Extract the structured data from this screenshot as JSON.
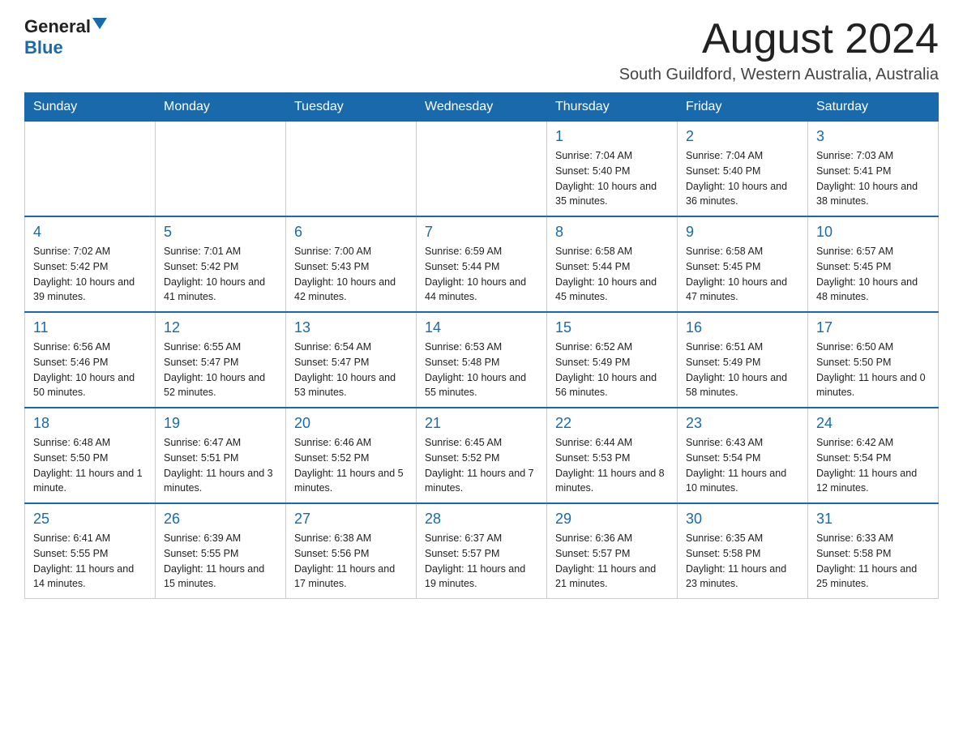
{
  "header": {
    "logo_general": "General",
    "logo_blue": "Blue",
    "month_title": "August 2024",
    "subtitle": "South Guildford, Western Australia, Australia"
  },
  "weekdays": [
    "Sunday",
    "Monday",
    "Tuesday",
    "Wednesday",
    "Thursday",
    "Friday",
    "Saturday"
  ],
  "weeks": [
    [
      {
        "day": "",
        "info": ""
      },
      {
        "day": "",
        "info": ""
      },
      {
        "day": "",
        "info": ""
      },
      {
        "day": "",
        "info": ""
      },
      {
        "day": "1",
        "info": "Sunrise: 7:04 AM\nSunset: 5:40 PM\nDaylight: 10 hours and 35 minutes."
      },
      {
        "day": "2",
        "info": "Sunrise: 7:04 AM\nSunset: 5:40 PM\nDaylight: 10 hours and 36 minutes."
      },
      {
        "day": "3",
        "info": "Sunrise: 7:03 AM\nSunset: 5:41 PM\nDaylight: 10 hours and 38 minutes."
      }
    ],
    [
      {
        "day": "4",
        "info": "Sunrise: 7:02 AM\nSunset: 5:42 PM\nDaylight: 10 hours and 39 minutes."
      },
      {
        "day": "5",
        "info": "Sunrise: 7:01 AM\nSunset: 5:42 PM\nDaylight: 10 hours and 41 minutes."
      },
      {
        "day": "6",
        "info": "Sunrise: 7:00 AM\nSunset: 5:43 PM\nDaylight: 10 hours and 42 minutes."
      },
      {
        "day": "7",
        "info": "Sunrise: 6:59 AM\nSunset: 5:44 PM\nDaylight: 10 hours and 44 minutes."
      },
      {
        "day": "8",
        "info": "Sunrise: 6:58 AM\nSunset: 5:44 PM\nDaylight: 10 hours and 45 minutes."
      },
      {
        "day": "9",
        "info": "Sunrise: 6:58 AM\nSunset: 5:45 PM\nDaylight: 10 hours and 47 minutes."
      },
      {
        "day": "10",
        "info": "Sunrise: 6:57 AM\nSunset: 5:45 PM\nDaylight: 10 hours and 48 minutes."
      }
    ],
    [
      {
        "day": "11",
        "info": "Sunrise: 6:56 AM\nSunset: 5:46 PM\nDaylight: 10 hours and 50 minutes."
      },
      {
        "day": "12",
        "info": "Sunrise: 6:55 AM\nSunset: 5:47 PM\nDaylight: 10 hours and 52 minutes."
      },
      {
        "day": "13",
        "info": "Sunrise: 6:54 AM\nSunset: 5:47 PM\nDaylight: 10 hours and 53 minutes."
      },
      {
        "day": "14",
        "info": "Sunrise: 6:53 AM\nSunset: 5:48 PM\nDaylight: 10 hours and 55 minutes."
      },
      {
        "day": "15",
        "info": "Sunrise: 6:52 AM\nSunset: 5:49 PM\nDaylight: 10 hours and 56 minutes."
      },
      {
        "day": "16",
        "info": "Sunrise: 6:51 AM\nSunset: 5:49 PM\nDaylight: 10 hours and 58 minutes."
      },
      {
        "day": "17",
        "info": "Sunrise: 6:50 AM\nSunset: 5:50 PM\nDaylight: 11 hours and 0 minutes."
      }
    ],
    [
      {
        "day": "18",
        "info": "Sunrise: 6:48 AM\nSunset: 5:50 PM\nDaylight: 11 hours and 1 minute."
      },
      {
        "day": "19",
        "info": "Sunrise: 6:47 AM\nSunset: 5:51 PM\nDaylight: 11 hours and 3 minutes."
      },
      {
        "day": "20",
        "info": "Sunrise: 6:46 AM\nSunset: 5:52 PM\nDaylight: 11 hours and 5 minutes."
      },
      {
        "day": "21",
        "info": "Sunrise: 6:45 AM\nSunset: 5:52 PM\nDaylight: 11 hours and 7 minutes."
      },
      {
        "day": "22",
        "info": "Sunrise: 6:44 AM\nSunset: 5:53 PM\nDaylight: 11 hours and 8 minutes."
      },
      {
        "day": "23",
        "info": "Sunrise: 6:43 AM\nSunset: 5:54 PM\nDaylight: 11 hours and 10 minutes."
      },
      {
        "day": "24",
        "info": "Sunrise: 6:42 AM\nSunset: 5:54 PM\nDaylight: 11 hours and 12 minutes."
      }
    ],
    [
      {
        "day": "25",
        "info": "Sunrise: 6:41 AM\nSunset: 5:55 PM\nDaylight: 11 hours and 14 minutes."
      },
      {
        "day": "26",
        "info": "Sunrise: 6:39 AM\nSunset: 5:55 PM\nDaylight: 11 hours and 15 minutes."
      },
      {
        "day": "27",
        "info": "Sunrise: 6:38 AM\nSunset: 5:56 PM\nDaylight: 11 hours and 17 minutes."
      },
      {
        "day": "28",
        "info": "Sunrise: 6:37 AM\nSunset: 5:57 PM\nDaylight: 11 hours and 19 minutes."
      },
      {
        "day": "29",
        "info": "Sunrise: 6:36 AM\nSunset: 5:57 PM\nDaylight: 11 hours and 21 minutes."
      },
      {
        "day": "30",
        "info": "Sunrise: 6:35 AM\nSunset: 5:58 PM\nDaylight: 11 hours and 23 minutes."
      },
      {
        "day": "31",
        "info": "Sunrise: 6:33 AM\nSunset: 5:58 PM\nDaylight: 11 hours and 25 minutes."
      }
    ]
  ]
}
